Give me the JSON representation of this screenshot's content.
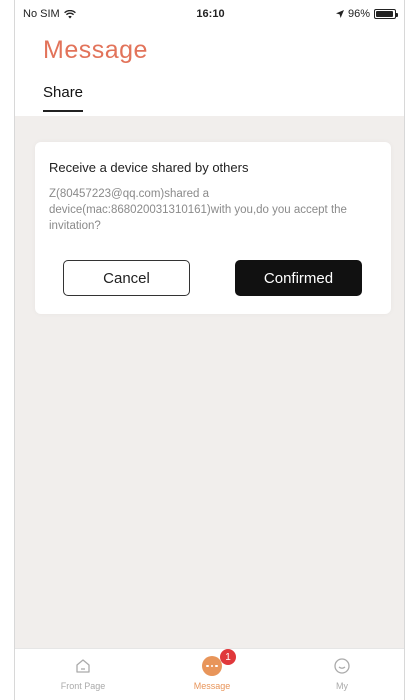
{
  "status_bar": {
    "carrier": "No SIM",
    "time": "16:10",
    "battery": "96%",
    "battery_level": 0.96
  },
  "header": {
    "title": "Message",
    "tabs": [
      {
        "label": "Share",
        "active": true
      }
    ]
  },
  "share_card": {
    "title": "Receive a device shared by others",
    "message": "Z(80457223@qq.com)shared a device(mac:868020031310161)with you,do you accept the invitation?",
    "cancel_label": "Cancel",
    "confirm_label": "Confirmed"
  },
  "bottom_nav": {
    "items": [
      {
        "label": "Front Page",
        "icon": "home-icon",
        "active": false
      },
      {
        "label": "Message",
        "icon": "message-icon",
        "active": true,
        "badge": "1"
      },
      {
        "label": "My",
        "icon": "smiley-icon",
        "active": false
      }
    ]
  },
  "colors": {
    "accent": "#e2735a",
    "nav_active": "#e8955a",
    "badge": "#e0383b",
    "content_bg": "#f1eeec"
  }
}
